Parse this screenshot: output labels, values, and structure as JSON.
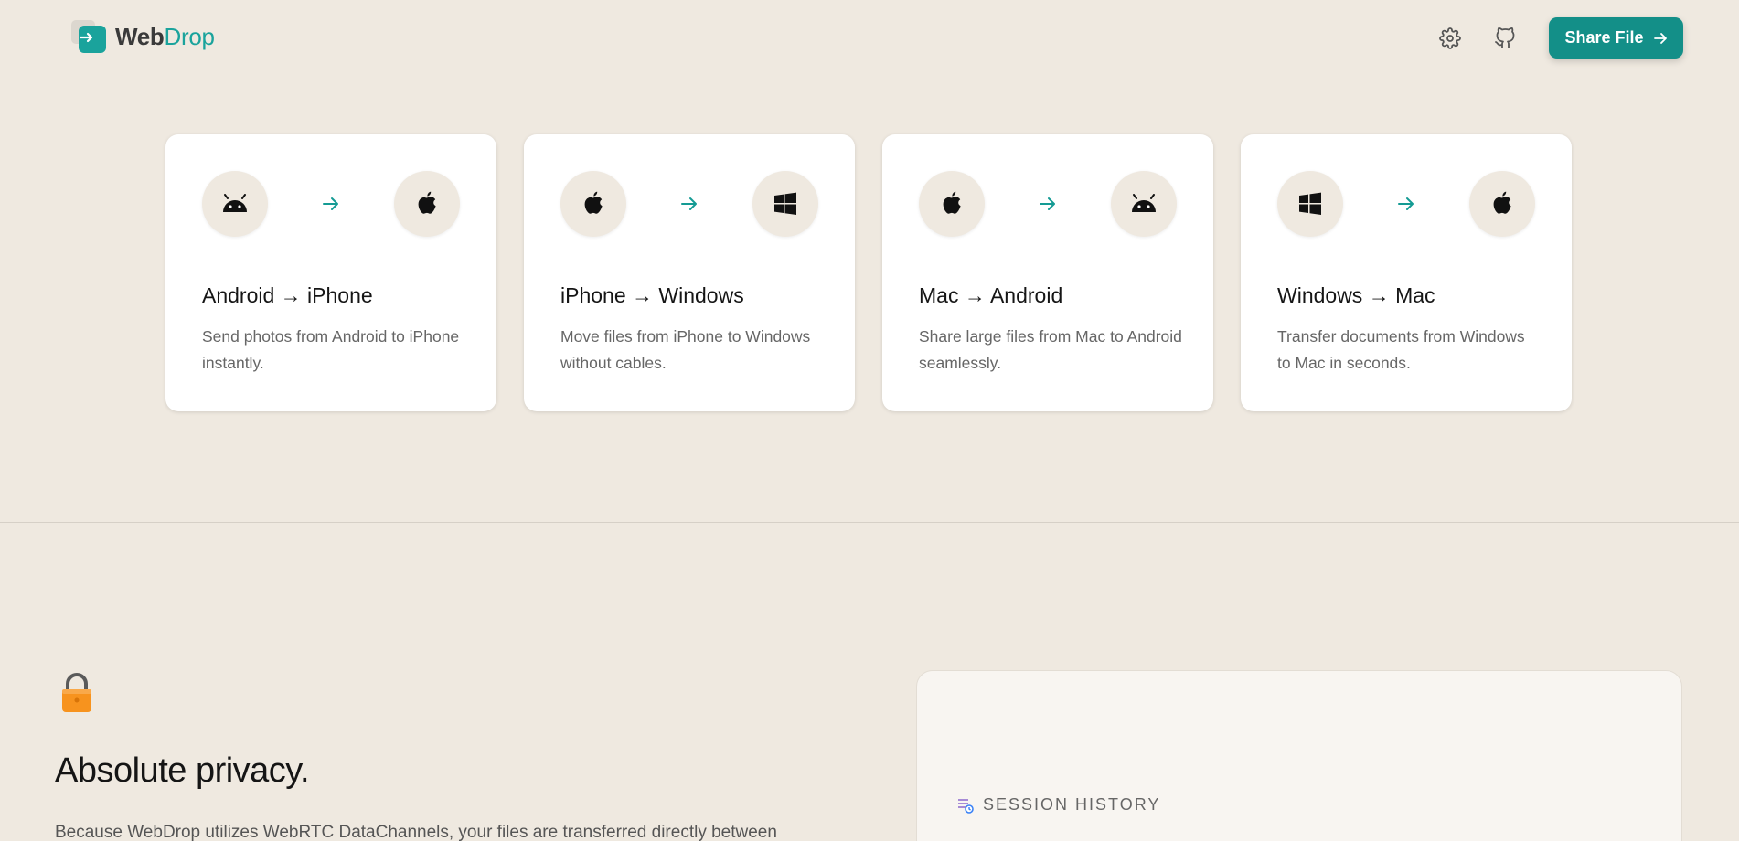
{
  "header": {
    "logo": {
      "text_main": "Web",
      "text_accent": "Drop"
    },
    "settings_icon": "gear-icon",
    "github_icon": "github-icon",
    "share_button": {
      "label": "Share File",
      "icon": "arrow-right-icon"
    }
  },
  "cards": [
    {
      "from_icon": "android-icon",
      "to_icon": "apple-icon",
      "title": "Android → iPhone",
      "description": "Send photos from Android to iPhone instantly."
    },
    {
      "from_icon": "apple-icon",
      "to_icon": "windows-icon",
      "title": "iPhone → Windows",
      "description": "Move files from iPhone to Windows without cables."
    },
    {
      "from_icon": "apple-icon",
      "to_icon": "android-icon",
      "title": "Mac → Android",
      "description": "Share large files from Mac to Android seamlessly."
    },
    {
      "from_icon": "windows-icon",
      "to_icon": "apple-icon",
      "title": "Windows → Mac",
      "description": "Transfer documents from Windows to Mac in seconds."
    }
  ],
  "privacy": {
    "icon": "lock-icon",
    "title": "Absolute privacy.",
    "text": "Because WebDrop utilizes WebRTC DataChannels, your files are transferred directly between"
  },
  "session_history": {
    "icon": "history-icon",
    "label": "SESSION HISTORY"
  },
  "colors": {
    "background": "#efe9e0",
    "accent": "#138f88",
    "card": "#ffffff"
  }
}
